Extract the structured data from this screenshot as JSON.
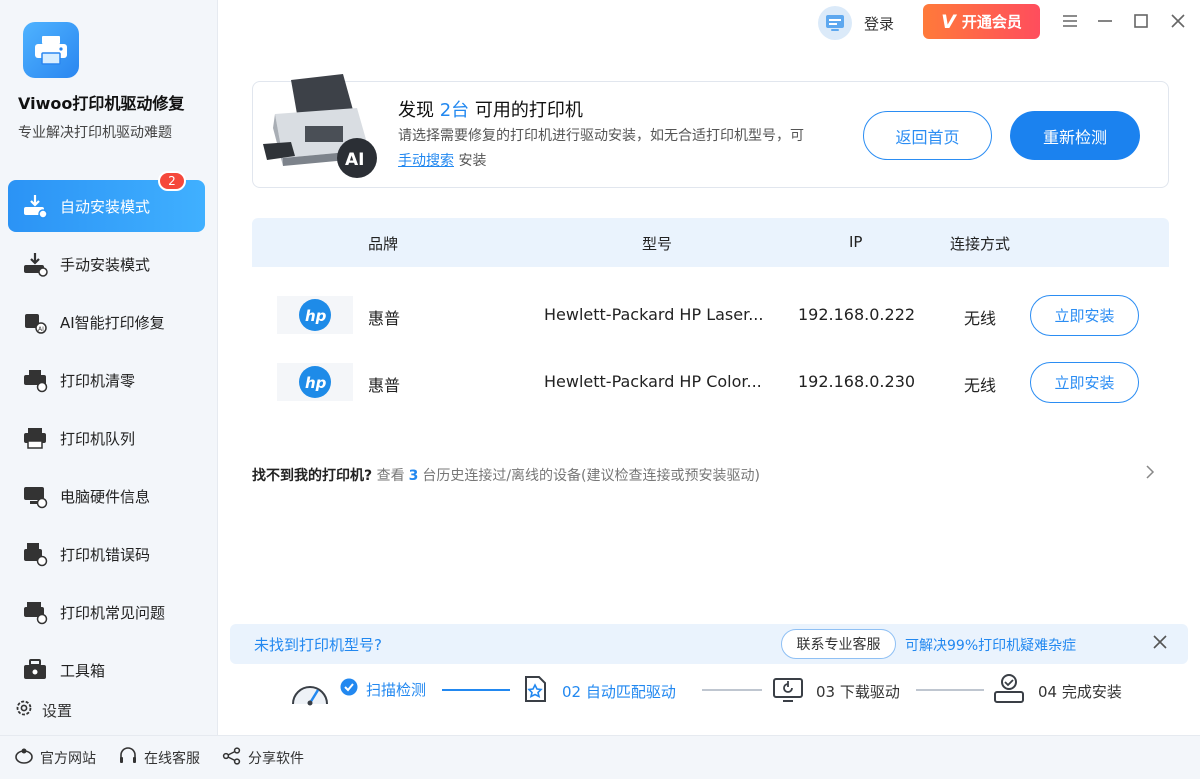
{
  "app": {
    "name": "Viwoo打印机驱动修复",
    "subtitle": "专业解决打印机驱动难题"
  },
  "sidebar": {
    "items": [
      {
        "label": "自动安装模式",
        "icon": "auto-install-icon",
        "active": true,
        "badge": "2"
      },
      {
        "label": "手动安装模式",
        "icon": "manual-install-icon"
      },
      {
        "label": "AI智能打印修复",
        "icon": "ai-repair-icon"
      },
      {
        "label": "打印机清零",
        "icon": "printer-reset-icon"
      },
      {
        "label": "打印机队列",
        "icon": "printer-queue-icon"
      },
      {
        "label": "电脑硬件信息",
        "icon": "hardware-info-icon"
      },
      {
        "label": "打印机错误码",
        "icon": "error-code-icon"
      },
      {
        "label": "打印机常见问题",
        "icon": "faq-icon"
      },
      {
        "label": "工具箱",
        "icon": "toolbox-icon"
      }
    ],
    "settings_label": "设置"
  },
  "topbar": {
    "login_label": "登录",
    "vip_label": "开通会员"
  },
  "banner": {
    "title_prefix": "发现",
    "title_count": "2台",
    "title_suffix": "可用的打印机",
    "desc_part1": "请选择需要修复的打印机进行驱动安装，如无合适打印机型号，可",
    "desc_link": "手动搜索",
    "desc_part2": "安装",
    "back_button": "返回首页",
    "rescan_button": "重新检测"
  },
  "table": {
    "headers": {
      "brand": "品牌",
      "model": "型号",
      "ip": "IP",
      "connection": "连接方式"
    },
    "rows": [
      {
        "brand": "惠普",
        "model": "Hewlett-Packard HP Laser...",
        "ip": "192.168.0.222",
        "connection": "无线",
        "action": "立即安装"
      },
      {
        "brand": "惠普",
        "model": "Hewlett-Packard HP Color...",
        "ip": "192.168.0.230",
        "connection": "无线",
        "action": "立即安装"
      }
    ]
  },
  "history": {
    "question": "找不到我的打印机?",
    "pre": "查看",
    "count": "3",
    "post": "台历史连接过/离线的设备(建议检查连接或预安装驱动)"
  },
  "notice": {
    "question": "未找到打印机型号?",
    "contact_button": "联系专业客服",
    "tip": "可解决99%打印机疑难杂症"
  },
  "steps": [
    {
      "label": "扫描检测",
      "state": "done"
    },
    {
      "label": "02 自动匹配驱动",
      "state": "active"
    },
    {
      "label": "03 下载驱动",
      "state": "pending"
    },
    {
      "label": "04 完成安装",
      "state": "pending"
    }
  ],
  "footer": {
    "website": "官方网站",
    "support": "在线客服",
    "share": "分享软件"
  },
  "colors": {
    "accent": "#1b82ef",
    "badge": "#f5483b",
    "vip_start": "#ff7a3a",
    "vip_end": "#ff4d5d"
  }
}
